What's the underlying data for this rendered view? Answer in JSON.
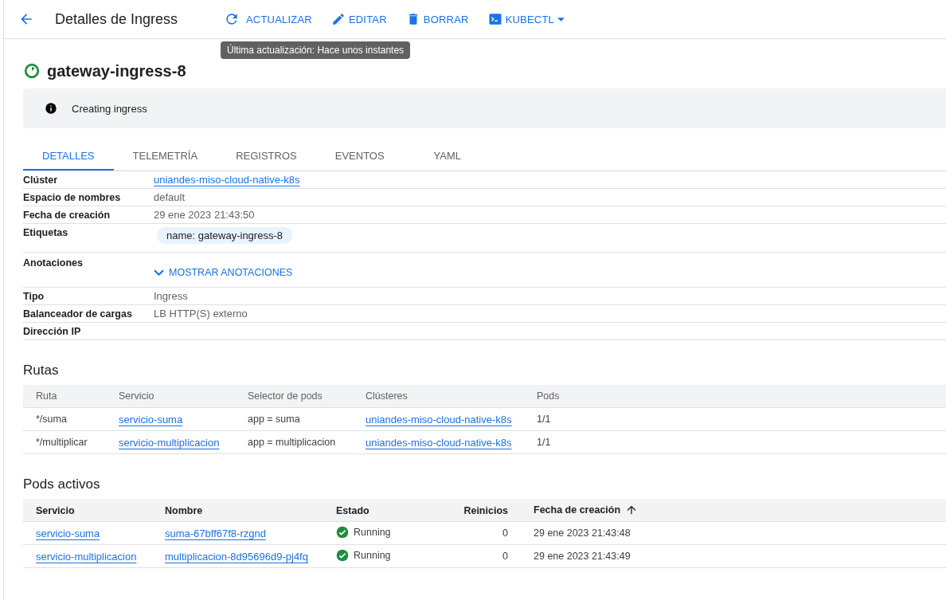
{
  "header": {
    "title": "Detalles de Ingress",
    "actions": [
      {
        "kind": "refresh",
        "label": "ACTUALIZAR"
      },
      {
        "kind": "edit",
        "label": "EDITAR"
      },
      {
        "kind": "delete",
        "label": "BORRAR"
      },
      {
        "kind": "terminal",
        "label": "KUBECTL"
      }
    ],
    "tooltip": "Última actualización: Hace unos instantes"
  },
  "resource": {
    "name": "gateway-ingress-8",
    "banner": "Creating ingress"
  },
  "tabs": [
    {
      "label": "DETALLES",
      "selected": true
    },
    {
      "label": "TELEMETRÍA",
      "selected": false
    },
    {
      "label": "REGISTROS",
      "selected": false
    },
    {
      "label": "EVENTOS",
      "selected": false
    },
    {
      "label": "YAML",
      "selected": false
    }
  ],
  "details": [
    {
      "label": "Clúster",
      "kind": "link",
      "value": "uniandes-miso-cloud-native-k8s"
    },
    {
      "label": "Espacio de nombres",
      "kind": "text",
      "value": "default"
    },
    {
      "label": "Fecha de creación",
      "kind": "text",
      "value": "29 ene 2023 21:43:50"
    },
    {
      "label": "Etiquetas",
      "kind": "chip",
      "value": "name: gateway-ingress-8"
    },
    {
      "label": "Anotaciones",
      "kind": "toggle",
      "value": "MOSTRAR ANOTACIONES"
    },
    {
      "label": "Tipo",
      "kind": "text",
      "value": "Ingress"
    },
    {
      "label": "Balanceador de cargas",
      "kind": "text",
      "value": "LB HTTP(S) externo"
    },
    {
      "label": "Dirección IP",
      "kind": "empty"
    }
  ],
  "routes": {
    "title": "Rutas",
    "columns": [
      "Ruta",
      "Servicio",
      "Selector de pods",
      "Clústeres",
      "Pods"
    ],
    "rows": [
      [
        {
          "kind": "text",
          "text": "*/suma"
        },
        {
          "kind": "link",
          "text": "servicio-suma"
        },
        {
          "kind": "text",
          "text": "app = suma"
        },
        {
          "kind": "link",
          "text": "uniandes-miso-cloud-native-k8s"
        },
        {
          "kind": "text",
          "text": "1/1"
        }
      ],
      [
        {
          "kind": "text",
          "text": "*/multiplicar"
        },
        {
          "kind": "link",
          "text": "servicio-multiplicacion"
        },
        {
          "kind": "text",
          "text": "app = multiplicacion"
        },
        {
          "kind": "link",
          "text": "uniandes-miso-cloud-native-k8s"
        },
        {
          "kind": "text",
          "text": "1/1"
        }
      ]
    ]
  },
  "pods": {
    "title": "Pods activos",
    "columns": [
      {
        "label": "Servicio",
        "sorted": false
      },
      {
        "label": "Nombre",
        "sorted": false
      },
      {
        "label": "Estado",
        "sorted": false
      },
      {
        "label": "Reinicios",
        "sorted": false
      },
      {
        "label": "Fecha de creación",
        "sorted": true
      }
    ],
    "rows": [
      [
        {
          "kind": "link",
          "text": "servicio-suma"
        },
        {
          "kind": "link",
          "text": "suma-67bff67f8-rzgnd"
        },
        {
          "kind": "status",
          "text": "Running"
        },
        {
          "kind": "number",
          "text": "0"
        },
        {
          "kind": "text",
          "text": "29 ene 2023 21:43:48"
        }
      ],
      [
        {
          "kind": "link",
          "text": "servicio-multiplicacion"
        },
        {
          "kind": "link",
          "text": "multiplicacion-8d95696d9-pj4fq"
        },
        {
          "kind": "status",
          "text": "Running"
        },
        {
          "kind": "number",
          "text": "0"
        },
        {
          "kind": "text",
          "text": "29 ene 2023 21:43:49"
        }
      ]
    ]
  }
}
